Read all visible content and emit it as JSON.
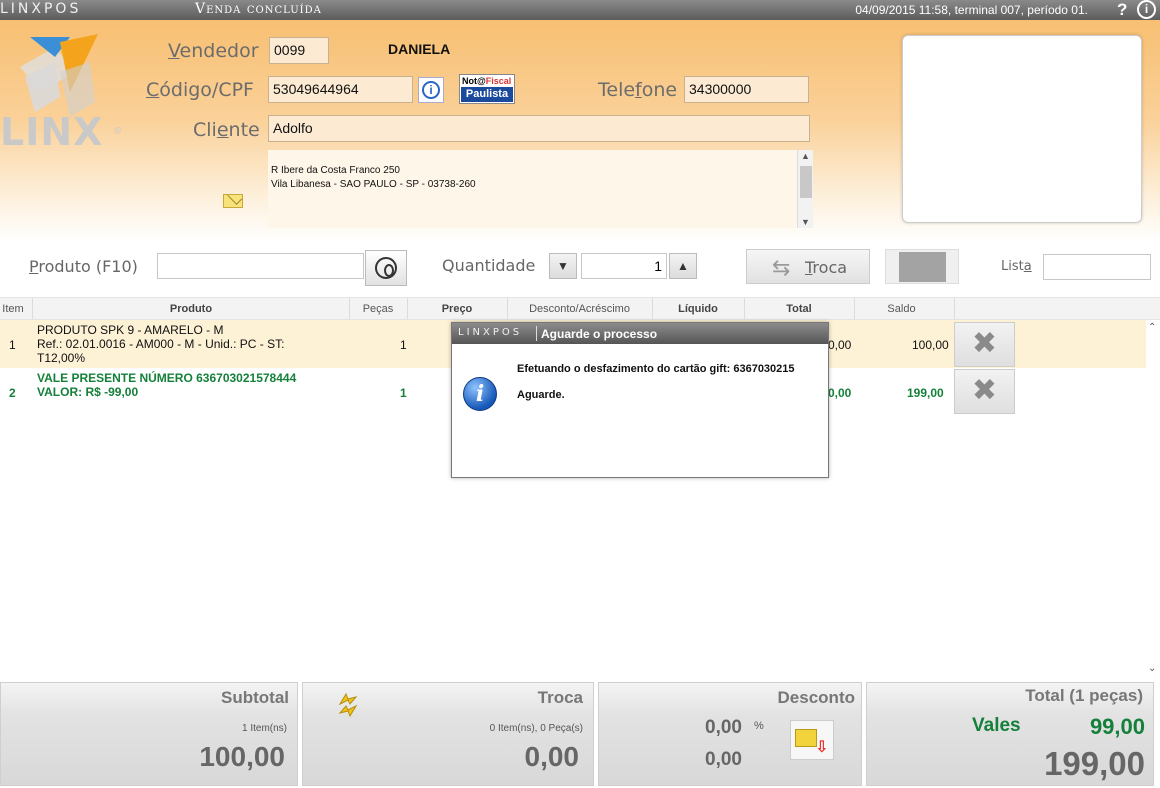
{
  "topbar": {
    "brand": "LINXPOS",
    "status": "Venda concluída",
    "info": "04/09/2015 11:58, terminal 007, período 01.",
    "help": "?",
    "about": "i"
  },
  "logo": {
    "text": "LINX",
    "reg": "®"
  },
  "header": {
    "vendedor_label_u": "V",
    "vendedor_label_rest": "endedor",
    "vendedor_code": "0099",
    "vendedor_name": "DANIELA",
    "codigo_label_u": "C",
    "codigo_label_rest": "ódigo/CPF",
    "codigo_value": "53049644964",
    "telefone_label_pre": "Tele",
    "telefone_label_u": "f",
    "telefone_label_rest": "one",
    "telefone_value": "34300000",
    "cliente_label_pre": "Cli",
    "cliente_label_u": "e",
    "cliente_label_rest": "nte",
    "cliente_value": "Adolfo",
    "address_line1": "R Ibere da Costa Franco 250",
    "address_line2": "Vila Libanesa - SAO PAULO - SP - 03738-260",
    "nfp_line1_a": "Not@",
    "nfp_line1_b": "Fiscal",
    "nfp_line2": "Paulista"
  },
  "productbar": {
    "produto_label_u": "P",
    "produto_label_rest": "roduto (F10)",
    "produto_value": "",
    "quantidade_label": "Quantidade",
    "quantidade_value": "1",
    "qty_down": "▼",
    "qty_up": "▲",
    "troca_label_u": "T",
    "troca_label_rest": "roca",
    "lista_label_pre": "List",
    "lista_label_u": "a",
    "lista_value": ""
  },
  "table": {
    "headers": [
      "Item",
      "Produto",
      "Peças",
      "Preço",
      "Desconto/Acréscimo",
      "Líquido",
      "Total",
      "Saldo"
    ],
    "rows": [
      {
        "item": "1",
        "produto_line1": "PRODUTO SPK 9 - AMARELO - M",
        "produto_line2": "Ref.: 02.01.0016 - AM000 - M - Unid.: PC - ST:",
        "produto_line3": "T12,00%",
        "pecas": "1",
        "total": "0,00",
        "saldo": "100,00"
      },
      {
        "item": "2",
        "produto_line1": "VALE PRESENTE NÚMERO 636703021578444",
        "produto_line2": "VALOR: R$ -99,00",
        "pecas": "1",
        "total": "0,00",
        "saldo": "199,00"
      }
    ]
  },
  "dialog": {
    "brand": "LINXPOS",
    "title": "Aguarde o processo",
    "message": "Efetuando o desfazimento do cartão gift: 6367030215",
    "message2": "Aguarde."
  },
  "footer": {
    "subtotal": {
      "title": "Subtotal",
      "sub": "1 Item(ns)",
      "value": "100,00"
    },
    "troca": {
      "title": "Troca",
      "sub": "0 Item(ns), 0 Peça(s)",
      "value": "0,00"
    },
    "desconto": {
      "title": "Desconto",
      "percent": "0,00",
      "percent_sign": "%",
      "value": "0,00"
    },
    "total": {
      "title": "Total (1 peças)",
      "vales_label": "Vales",
      "vales_value": "99,00",
      "value": "199,00"
    }
  },
  "colors": {
    "accent_orange": "#f7bf72",
    "green": "#14803a",
    "dialog_title": "#555555"
  }
}
